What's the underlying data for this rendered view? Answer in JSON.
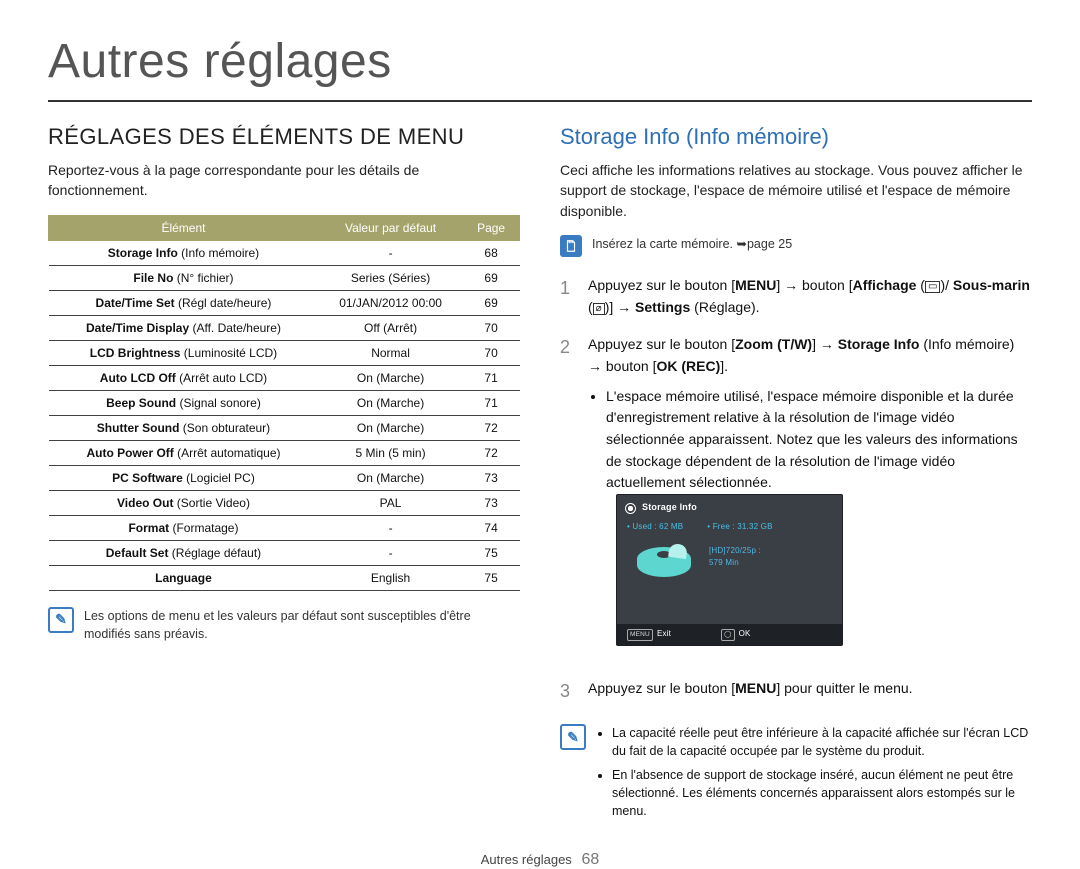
{
  "page_title": "Autres réglages",
  "left": {
    "heading": "RÉGLAGES DES ÉLÉMENTS DE MENU",
    "intro": "Reportez-vous à la page correspondante pour les détails de fonctionnement.",
    "table": {
      "headers": {
        "element": "Élément",
        "default": "Valeur par défaut",
        "page": "Page"
      },
      "rows": [
        {
          "name_b": "Storage Info",
          "name_p": " (Info mémoire)",
          "def": "-",
          "page": "68"
        },
        {
          "name_b": "File No",
          "name_p": " (N° fichier)",
          "def": "Series (Séries)",
          "page": "69"
        },
        {
          "name_b": "Date/Time Set",
          "name_p": " (Régl date/heure)",
          "def": "01/JAN/2012 00:00",
          "page": "69"
        },
        {
          "name_b": "Date/Time Display",
          "name_p": " (Aff. Date/heure)",
          "def": "Off (Arrêt)",
          "page": "70"
        },
        {
          "name_b": "LCD Brightness",
          "name_p": " (Luminosité LCD)",
          "def": "Normal",
          "page": "70"
        },
        {
          "name_b": "Auto LCD Off",
          "name_p": " (Arrêt auto LCD)",
          "def": "On (Marche)",
          "page": "71"
        },
        {
          "name_b": "Beep Sound",
          "name_p": " (Signal sonore)",
          "def": "On (Marche)",
          "page": "71"
        },
        {
          "name_b": "Shutter Sound",
          "name_p": " (Son obturateur)",
          "def": "On (Marche)",
          "page": "72"
        },
        {
          "name_b": "Auto Power Off",
          "name_p": " (Arrêt automatique)",
          "def": "5 Min (5 min)",
          "page": "72"
        },
        {
          "name_b": "PC Software",
          "name_p": " (Logiciel PC)",
          "def": "On (Marche)",
          "page": "73"
        },
        {
          "name_b": "Video Out",
          "name_p": " (Sortie Video)",
          "def": "PAL",
          "page": "73"
        },
        {
          "name_b": "Format",
          "name_p": " (Formatage)",
          "def": "-",
          "page": "74"
        },
        {
          "name_b": "Default Set",
          "name_p": " (Réglage défaut)",
          "def": "-",
          "page": "75"
        },
        {
          "name_b": "Language",
          "name_p": "",
          "def": "English",
          "page": "75"
        }
      ]
    },
    "note_icon_label": "note",
    "note_text": "Les options de menu et les valeurs par défaut sont susceptibles d'être modifiés sans préavis."
  },
  "right": {
    "heading": "Storage Info (Info mémoire)",
    "intro": "Ceci affiche les informations relatives au stockage. Vous pouvez afficher le support de stockage, l'espace de mémoire utilisé et l'espace de mémoire disponible.",
    "sd_note": "Insérez la carte mémoire. ➥page 25",
    "steps": {
      "s1_pre": "Appuyez sur le bouton [",
      "s1_menu": "MENU",
      "s1_mid1": "] → bouton [",
      "s1_affichage": "Affichage",
      "s1_mid2": " (",
      "s1_iconA": "▭",
      "s1_mid3": ")/ ",
      "s1_sousmarin": "Sous-marin",
      "s1_mid4": " (",
      "s1_iconB": "⌀",
      "s1_mid5": ")] → ",
      "s1_settings": "Settings",
      "s1_end": " (Réglage).",
      "s2_pre": "Appuyez sur le bouton [",
      "s2_zoom": "Zoom (T/W)",
      "s2_mid1": "] → ",
      "s2_storage": "Storage Info",
      "s2_mid2": " (Info mémoire) → bouton [",
      "s2_okrec": "OK (REC)",
      "s2_end": "].",
      "s2_bullet": "L'espace mémoire utilisé, l'espace mémoire disponible et la durée d'enregistrement relative à la résolution de l'image vidéo sélectionnée apparaissent. Notez que les valeurs des informations de stockage dépendent de la résolution de l'image vidéo actuellement sélectionnée.",
      "s3_pre": "Appuyez sur le bouton [",
      "s3_menu": "MENU",
      "s3_end": "] pour quitter le menu."
    },
    "lcd": {
      "title": "Storage Info",
      "used_label": "• Used : 62 MB",
      "free_label": "• Free : 31.32 GB",
      "res": "[HD]720/25p :",
      "duration": "579 Min",
      "exit_key": "MENU",
      "exit": "Exit",
      "ok_key": "◯",
      "ok": "OK"
    },
    "final_notes": [
      "La capacité réelle peut être inférieure à la capacité affichée sur l'écran LCD du fait de la capacité occupée par le système du produit.",
      "En l'absence de support de stockage inséré, aucun élément ne peut être sélectionné. Les éléments concernés apparaissent alors estompés sur le menu."
    ]
  },
  "footer": {
    "section": "Autres réglages",
    "page": "68"
  }
}
